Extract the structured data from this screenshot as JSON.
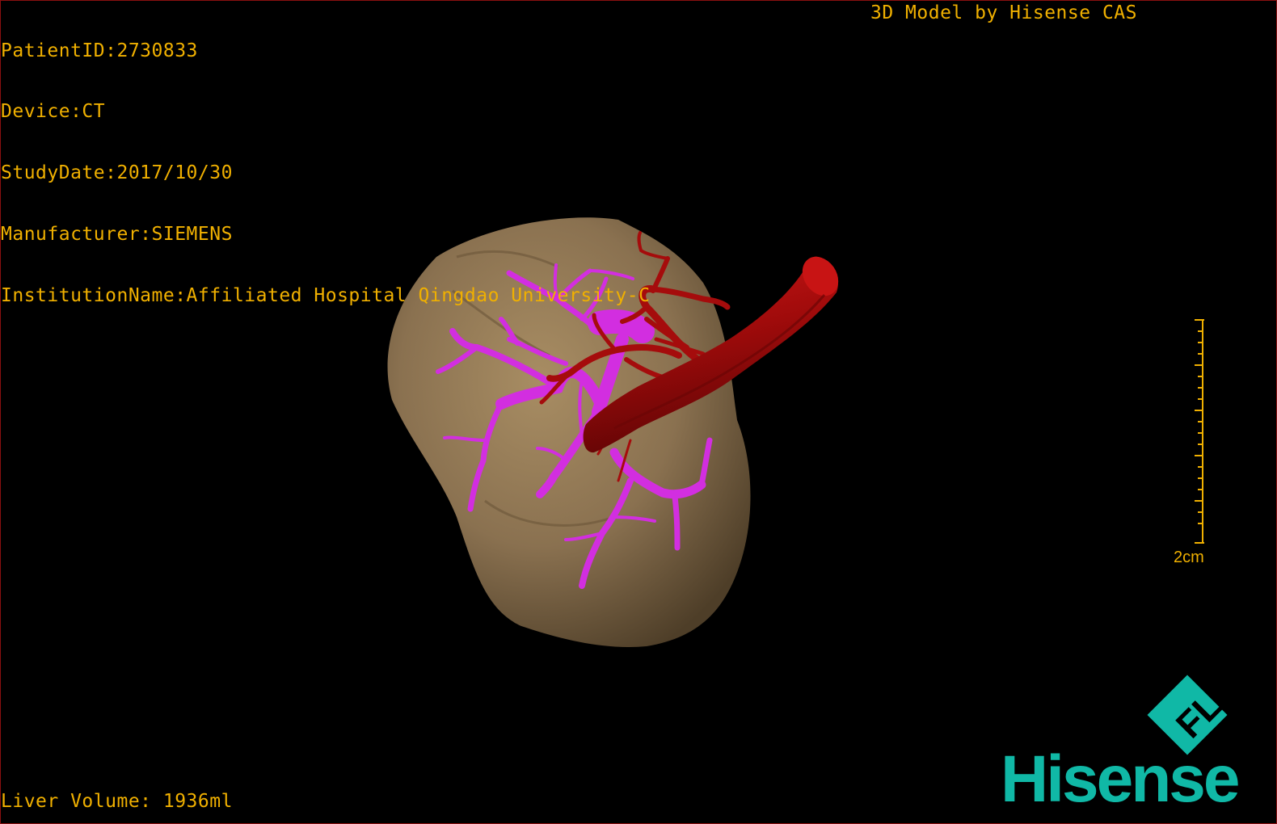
{
  "overlay": {
    "patient_id": "PatientID:2730833",
    "device": "Device:CT",
    "study_date": "StudyDate:2017/10/30",
    "manufacturer": "Manufacturer:SIEMENS",
    "institution": "InstitutionName:Affiliated Hospital Qingdao University-C",
    "credit": "3D Model by Hisense CAS",
    "liver_volume": "Liver Volume: 1936ml"
  },
  "scale_bar": {
    "label": "2cm"
  },
  "logo": {
    "text": "Hisense",
    "mark_letters": "FL"
  },
  "colors": {
    "overlay_text": "#f0b000",
    "liver": "#8b7350",
    "portal_vein": "#d22ee0",
    "artery": "#b10d0d",
    "logo": "#10b8a6"
  },
  "icons": [
    "hisense-fl-logo-icon"
  ]
}
